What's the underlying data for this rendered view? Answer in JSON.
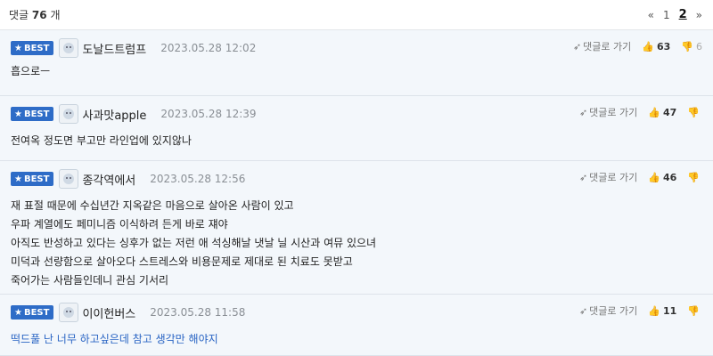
{
  "header": {
    "count_prefix": "댓글",
    "count": "76",
    "count_suffix": "개",
    "pager": {
      "first": "«",
      "p1": "1",
      "p2": "2",
      "next": "»"
    }
  },
  "comments": [
    {
      "badge": "BEST",
      "nick": "도날드트럼프",
      "date": "2023.05.28 12:02",
      "reply": "댓글로 가기",
      "up": "63",
      "down": "6",
      "lines": [
        "흡으로ㅡ"
      ]
    },
    {
      "badge": "BEST",
      "nick": "사과맛apple",
      "date": "2023.05.28 12:39",
      "reply": "댓글로 가기",
      "up": "47",
      "down": "",
      "lines": [
        "전여옥 정도면 부고만 라인업에 있지않나"
      ]
    },
    {
      "badge": "BEST",
      "nick": "종각역에서",
      "date": "2023.05.28 12:56",
      "reply": "댓글로 가기",
      "up": "46",
      "down": "",
      "lines": [
        "재 표절 때문에 수십년간 지옥같은 마음으로 살아온 사람이 있고",
        "우파 계열에도 페미니즘 이식하려 든게 바로 쟤야",
        "아직도 반성하고 있다는 싱후가 없는 저런 애 석싱해날 냇날 닐 시산과 여뮤 있으녀",
        "미덕과 선량함으로 살아오다 스트레스와 비용문제로 제대로 된 치료도 못받고",
        "죽어가는 사람들인데니 관심 기서리"
      ]
    },
    {
      "badge": "BEST",
      "nick": "이이헌버스",
      "date": "2023.05.28 11:58",
      "reply": "댓글로 가기",
      "up": "11",
      "down": "",
      "lines": [
        "떡드풀 난 너무 하고싶은데 참고 생각만 해야지"
      ]
    }
  ],
  "colors": {
    "best_badge": "#2e6cc7",
    "row_bg": "#f3f7fb",
    "link_blue": "#2a65c4"
  }
}
